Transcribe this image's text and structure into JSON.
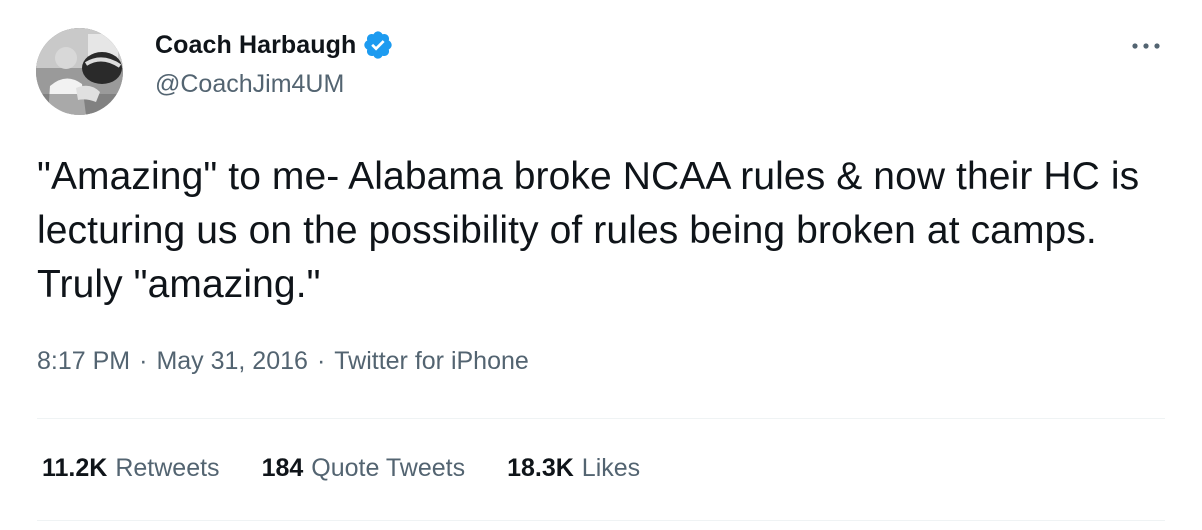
{
  "author": {
    "display_name": "Coach Harbaugh",
    "handle": "@CoachJim4UM",
    "verified": true,
    "verified_icon": "verified-badge-icon",
    "avatar_icon": "profile-avatar-image"
  },
  "tweet": {
    "text": "\"Amazing\" to me- Alabama broke NCAA rules & now their HC is lecturing us on the possibility of rules being broken at camps. Truly \"amazing.\""
  },
  "meta": {
    "time": "8:17 PM",
    "separator": "·",
    "date": "May 31, 2016",
    "source": "Twitter for iPhone"
  },
  "stats": {
    "retweets_count": "11.2K",
    "retweets_label": "Retweets",
    "quotes_count": "184",
    "quotes_label": "Quote Tweets",
    "likes_count": "18.3K",
    "likes_label": "Likes"
  },
  "colors": {
    "text_primary": "#0f1419",
    "text_secondary": "#536471",
    "verified_blue": "#1d9bf0",
    "divider": "#eff3f4"
  },
  "more_icon": "more-options-icon"
}
